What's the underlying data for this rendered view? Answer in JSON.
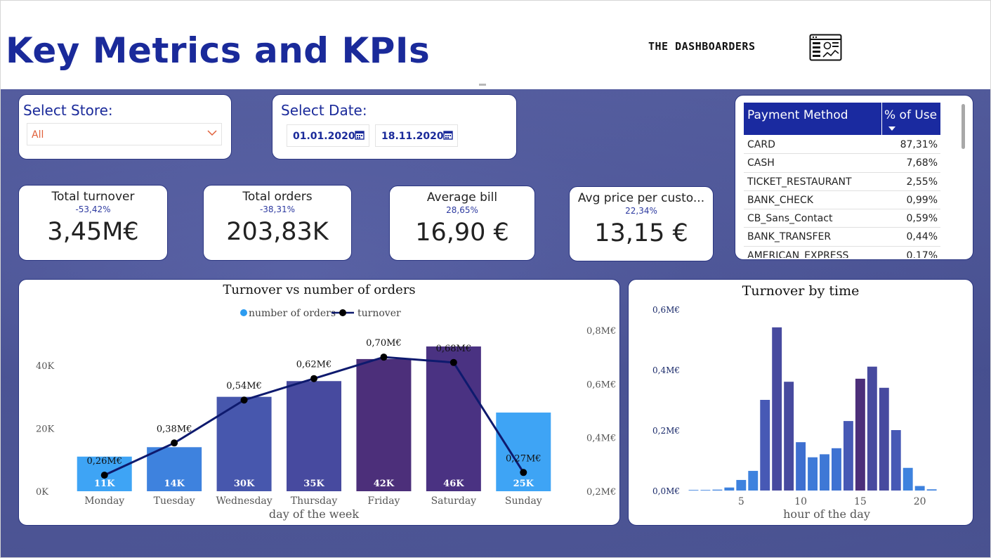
{
  "header": {
    "title": "Key Metrics and KPIs",
    "brand": "THE DASHBOARDERS",
    "brand_icon": "dashboard-window-icon"
  },
  "store_slicer": {
    "label": "Select Store:",
    "value": "All",
    "icon": "chevron-down-icon"
  },
  "date_slicer": {
    "label": "Select Date:",
    "start": "01.01.2020",
    "end": "18.11.2020",
    "icon": "calendar-icon"
  },
  "kpis": [
    {
      "label": "Total turnover",
      "delta": "-53,42%",
      "value": "3,45M€"
    },
    {
      "label": "Total orders",
      "delta": "-38,31%",
      "value": "203,83K"
    },
    {
      "label": "Average bill",
      "delta": "28,65%",
      "value": "16,90 €"
    },
    {
      "label": "Avg price per custo...",
      "delta": "22,34%",
      "value": "13,15 €"
    }
  ],
  "payment_table": {
    "col_method": "Payment Method",
    "col_pct": "% of Use",
    "rows": [
      {
        "method": "CARD",
        "pct": "87,31%"
      },
      {
        "method": "CASH",
        "pct": "7,68%"
      },
      {
        "method": "TICKET_RESTAURANT",
        "pct": "2,55%"
      },
      {
        "method": "BANK_CHECK",
        "pct": "0,99%"
      },
      {
        "method": "CB_Sans_Contact",
        "pct": "0,59%"
      },
      {
        "method": "BANK_TRANSFER",
        "pct": "0,44%"
      },
      {
        "method": "AMERICAN_EXPRESS",
        "pct": "0,17%"
      }
    ]
  },
  "colors": {
    "title_blue": "#1a2a9a",
    "line": "#0e1a6e",
    "legend_bar": "#2d9cf0"
  },
  "chart_data": [
    {
      "type": "bar",
      "title": "Turnover vs number of orders",
      "xlabel": "day of the week",
      "ylabel": "",
      "categories": [
        "Monday",
        "Tuesday",
        "Wednesday",
        "Thursday",
        "Friday",
        "Saturday",
        "Sunday"
      ],
      "series": [
        {
          "name": "number of orders",
          "type": "bar",
          "values": [
            11,
            14,
            30,
            35,
            42,
            46,
            25
          ],
          "labels": [
            "11K",
            "14K",
            "30K",
            "35K",
            "42K",
            "46K",
            "25K"
          ],
          "colors": [
            "#3ea4f5",
            "#3e82de",
            "#4757ad",
            "#474a9f",
            "#4c2f7a",
            "#4a3282",
            "#3ea4f5"
          ]
        },
        {
          "name": "turnover",
          "type": "line",
          "axis": "right",
          "values": [
            0.26,
            0.38,
            0.54,
            0.62,
            0.7,
            0.68,
            0.27
          ],
          "labels": [
            "0,26M€",
            "0,38M€",
            "0,54M€",
            "0,62M€",
            "0,70M€",
            "0,68M€",
            "0,27M€"
          ]
        }
      ],
      "y_left": {
        "ticks": [
          "0K",
          "20K",
          "40K"
        ],
        "tick_values": [
          0,
          20,
          40
        ],
        "range": [
          0,
          46
        ]
      },
      "y_right": {
        "ticks": [
          "0,2M€",
          "0,4M€",
          "0,6M€",
          "0,8M€"
        ],
        "tick_values": [
          0.2,
          0.4,
          0.6,
          0.8
        ],
        "range": [
          0.2,
          0.8
        ]
      },
      "legend": "top-center",
      "grid": false
    },
    {
      "type": "bar",
      "title": "Turnover by time",
      "xlabel": "hour of the day",
      "ylabel": "",
      "x": [
        1,
        2,
        3,
        4,
        5,
        6,
        7,
        8,
        9,
        10,
        11,
        12,
        13,
        14,
        15,
        16,
        17,
        18,
        19,
        20,
        21,
        22,
        23
      ],
      "values": [
        0.002,
        0.002,
        0.003,
        0.01,
        0.035,
        0.065,
        0.3,
        0.54,
        0.36,
        0.16,
        0.11,
        0.12,
        0.14,
        0.23,
        0.37,
        0.41,
        0.34,
        0.2,
        0.075,
        0.015,
        0.004,
        0.0,
        0.0
      ],
      "colors": [
        "#3e82de",
        "#3e82de",
        "#3e82de",
        "#3e82de",
        "#3e82de",
        "#3e82de",
        "#4759b5",
        "#474a9f",
        "#474a9f",
        "#3e6fd0",
        "#3e7ad8",
        "#3e78d6",
        "#3e72d2",
        "#4759b5",
        "#4c2f7a",
        "#474a9f",
        "#474a9f",
        "#4759b5",
        "#3e82de",
        "#3e82de",
        "#3e82de",
        "#3e82de",
        "#3e82de"
      ],
      "x_ticks": [
        "5",
        "10",
        "15",
        "20"
      ],
      "x_tick_values": [
        5,
        10,
        15,
        20
      ],
      "y_ticks": [
        "0,0M€",
        "0,2M€",
        "0,4M€",
        "0,6M€"
      ],
      "y_tick_values": [
        0,
        0.2,
        0.4,
        0.6
      ],
      "ylim": [
        0,
        0.6
      ],
      "xlim": [
        0.5,
        23.5
      ],
      "grid": false
    }
  ]
}
